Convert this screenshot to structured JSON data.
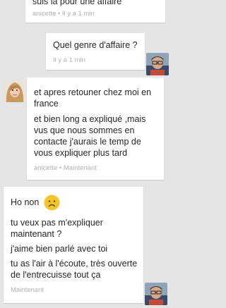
{
  "messages": [
    {
      "text": "suis la pour une affaire",
      "meta": "anicette • Il y a 1 min"
    },
    {
      "text": "Quel genre d'affaire ?",
      "meta": "Il y a 1 min"
    },
    {
      "paragraphs": [
        "et apres retouner chez moi en france",
        "et bien long a expliqué ,mais vus que nous sommes en contacte j'aurais le temp de vous expliquer plus tard"
      ],
      "meta": "anicette • Maintenant"
    },
    {
      "paragraphs": [
        "Ho non",
        "tu veux pas m'expliquer maintenant ?",
        "j'aime bien parlé avec toi",
        "tu as l'air à l'écoute, très ouverte de l'entrecuisse tout ça"
      ],
      "emoji": "sad-face-icon",
      "meta": "Maintenant"
    }
  ],
  "colors": {
    "background": "#e5e5e5",
    "bubble": "#ffffff",
    "meta_text": "#b4b4b4",
    "emoji_face": "#f5c52a"
  }
}
